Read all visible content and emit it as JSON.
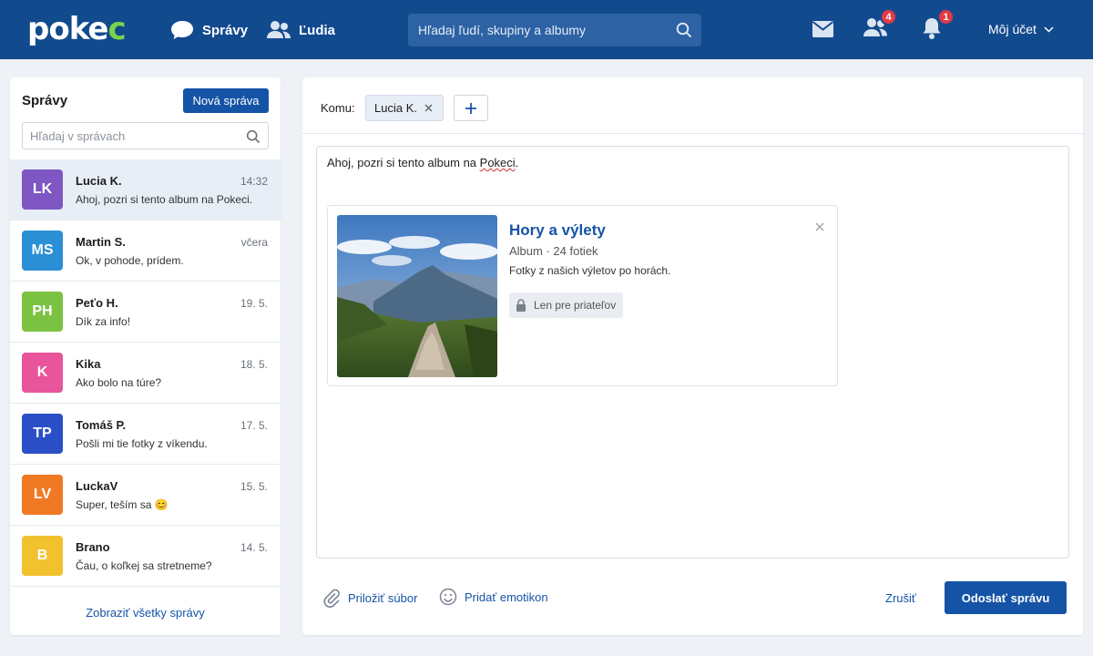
{
  "header": {
    "logo_main": "poke",
    "logo_accent": "c",
    "nav": [
      {
        "label": "Správy",
        "icon": "chat-bubble-icon"
      },
      {
        "label": "Ľudia",
        "icon": "people-icon"
      }
    ],
    "search_placeholder": "Hľadaj ľudí, skupiny a albumy",
    "friends_badge": "4",
    "notifications_badge": "1",
    "account_label": "Môj účet",
    "colors": {
      "bar": "#124a8e",
      "badge": "#e53945",
      "logo_accent": "#7bd24b"
    }
  },
  "sidebar": {
    "title": "Správy",
    "new_message_label": "Nová správa",
    "search_placeholder": "Hľadaj v správach",
    "conversations": [
      {
        "initials": "LK",
        "name": "Lucia K.",
        "time": "14:32",
        "preview": "Ahoj, pozri si tento album na Pokeci.",
        "color": "#7e57c2",
        "active": true
      },
      {
        "initials": "MS",
        "name": "Martin S.",
        "time": "včera",
        "preview": "Ok, v pohode, prídem.",
        "color": "#2b8fd6",
        "active": false
      },
      {
        "initials": "PH",
        "name": "Peťo H.",
        "time": "19. 5.",
        "preview": "Dík za info!",
        "color": "#7cc242",
        "active": false
      },
      {
        "initials": "K",
        "name": "Kika",
        "time": "18. 5.",
        "preview": "Ako bolo na túre?",
        "color": "#e9559a",
        "active": false
      },
      {
        "initials": "TP",
        "name": "Tomáš P.",
        "time": "17. 5.",
        "preview": "Pošli mi tie fotky z víkendu.",
        "color": "#2b4fc7",
        "active": false
      },
      {
        "initials": "LV",
        "name": "LuckaV",
        "time": "15. 5.",
        "preview": "Super, teším sa 😊",
        "color": "#f07a24",
        "active": false
      },
      {
        "initials": "B",
        "name": "Brano",
        "time": "14. 5.",
        "preview": "Čau, o koľkej sa stretneme?",
        "color": "#f2c12e",
        "active": false
      }
    ],
    "show_all_label": "Zobraziť všetky správy"
  },
  "compose": {
    "to_label": "Komu:",
    "recipient": "Lucia K.",
    "message_before": "Ahoj, pozri si tento album na ",
    "message_highlight": "Pokeci",
    "message_after": ".",
    "album": {
      "title": "Hory a výlety",
      "meta": "Album · 24 fotiek",
      "description": "Fotky z našich výletov po horách.",
      "privacy": "Len pre priateľov"
    },
    "attach_label": "Priložiť súbor",
    "emoji_label": "Pridať emotikon",
    "cancel_label": "Zrušiť",
    "send_label": "Odoslať správu"
  }
}
